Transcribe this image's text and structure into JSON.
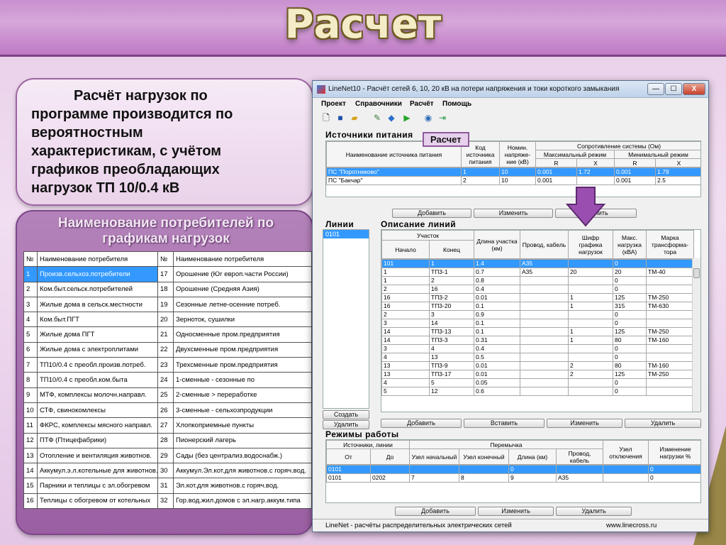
{
  "slide": {
    "title": "Расчет",
    "intro_lines": [
      "Расчёт нагрузок по",
      "программе производится по",
      "вероятностным",
      "характеристикам, с учётом",
      "графиков преобладающих",
      "нагрузок  ТП 10/0.4 кВ"
    ],
    "list_title_1": "Наименование потребителей по",
    "list_title_2": "графикам нагрузок"
  },
  "consumers": {
    "header": [
      "№",
      "Наименование потребителя",
      "№",
      "Наименование потребителя"
    ],
    "rows": [
      [
        "1",
        "Произв.сельхоз.потребители",
        "17",
        "Орошение (Юг европ.части России)"
      ],
      [
        "2",
        "Ком.быт.сельск.потребителей",
        "18",
        "Орошение (Средняя Азия)"
      ],
      [
        "3",
        "Жилые дома в сельск.местности",
        "19",
        "Сезонные летне-осенние потреб."
      ],
      [
        "4",
        "Ком.быт.ПГТ",
        "20",
        "Зерноток, сушилки"
      ],
      [
        "5",
        "Жилые дома ПГТ",
        "21",
        "Односменные пром.предприятия"
      ],
      [
        "6",
        "Жилые дома с электроплитами",
        "22",
        "Двухсменные пром.предприятия"
      ],
      [
        "7",
        "ТП10/0.4 с преобл.произв.потреб.",
        "23",
        "Трехсменные пром.предприятия"
      ],
      [
        "8",
        "ТП10/0.4 с преобл.ком.быта",
        "24",
        "1-сменные -  сезонные по"
      ],
      [
        "9",
        "МТФ, комплексы молочн.направл.",
        "25",
        "2-сменные  >  переработке"
      ],
      [
        "10",
        "СТФ, свинокомлексы",
        "26",
        "3-сменные -  сельхозпродукции"
      ],
      [
        "11",
        "ФКРС, комплексы мясного направл.",
        "27",
        "Хлопкоприемные пункты"
      ],
      [
        "12",
        "ПТФ (Птицефабрики)",
        "28",
        "Пионерский лагерь"
      ],
      [
        "13",
        "Отопление и вентиляция животнов.",
        "29",
        "Сады (без централиз.водоснабж.)"
      ],
      [
        "14",
        "Аккумул.э.л.котельные для животнов.",
        "30",
        "Аккумул.Эл.кот.для животнов.с горяч.вод."
      ],
      [
        "15",
        "Парники и теплицы с эл.обогревом",
        "31",
        "Эл.кот.для животнов.с горяч.вод."
      ],
      [
        "16",
        "Теплицы с обогревом от котельных",
        "32",
        "Гор.вод.жил.домов с эл.нагр.аккум.типа"
      ]
    ]
  },
  "window": {
    "title": "LineNet10 - Расчёт сетей 6, 10, 20 кВ на потери напряжения и токи короткого замыкания",
    "buttons": [
      "—",
      "☐",
      "X"
    ],
    "menu": [
      "Проект",
      "Справочники",
      "Расчёт",
      "Помощь"
    ],
    "tooltip": "Расчет",
    "status_left": "LineNet - расчёты распределительных электрических сетей",
    "status_right": "www.linecross.ru"
  },
  "sources": {
    "label": "Источники питания",
    "h_name": "Наименование источника питания",
    "h_code": "Код источника питания",
    "h_nom": "Номин. напряже-ние (кВ)",
    "h_res": "Сопротивление системы (Ом)",
    "h_max": "Максимальный режим",
    "h_min": "Минимальный режим",
    "h_r": "R",
    "h_x": "X",
    "rows": [
      [
        "ПС \"Поротниково\"",
        "1",
        "10",
        "0.001",
        "1.72",
        "0.001",
        "1.79"
      ],
      [
        "ПС \"Бакчар\"",
        "2",
        "10",
        "0.001",
        "",
        "0.001",
        "2.5"
      ]
    ],
    "btn_add": "Добавить",
    "btn_edit": "Изменить",
    "btn_del": "Удалить"
  },
  "lines": {
    "label": "Линии",
    "items": [
      "0101"
    ],
    "btn_create": "Создать",
    "btn_delete": "Удалить"
  },
  "desc": {
    "label": "Описание линий",
    "h_section": "Участок",
    "h_start": "Начало",
    "h_end": "Конец",
    "h_len": "Длина участка (км)",
    "h_wire": "Провод, кабель",
    "h_code": "Шифр графика нагрузок",
    "h_max": "Макс. нагрузка (кВА)",
    "h_tr": "Марка трансформа-тора",
    "rows": [
      [
        "101",
        "1",
        "1.4",
        "А35",
        "",
        "0",
        ""
      ],
      [
        "1",
        "ТП3-1",
        "0.7",
        "А35",
        "20",
        "20",
        "ТМ-40"
      ],
      [
        "1",
        "2",
        "0.8",
        "",
        "",
        "0",
        ""
      ],
      [
        "2",
        "16",
        "0.4",
        "",
        "",
        "0",
        ""
      ],
      [
        "16",
        "ТП3-2",
        "0.01",
        "",
        "1",
        "125",
        "ТМ-250"
      ],
      [
        "16",
        "ТП3-20",
        "0.1",
        "",
        "1",
        "315",
        "ТМ-630"
      ],
      [
        "2",
        "3",
        "0.9",
        "",
        "",
        "0",
        ""
      ],
      [
        "3",
        "14",
        "0.1",
        "",
        "",
        "0",
        ""
      ],
      [
        "14",
        "ТП3-13",
        "0.1",
        "",
        "1",
        "125",
        "ТМ-250"
      ],
      [
        "14",
        "ТП3-3",
        "0.31",
        "",
        "1",
        "80",
        "ТМ-160"
      ],
      [
        "3",
        "4",
        "0.4",
        "",
        "",
        "0",
        ""
      ],
      [
        "4",
        "13",
        "0.5",
        "",
        "",
        "0",
        ""
      ],
      [
        "13",
        "ТП3-9",
        "0.01",
        "",
        "2",
        "80",
        "ТМ-160"
      ],
      [
        "13",
        "ТП3-17",
        "0.01",
        "",
        "2",
        "125",
        "ТМ-250"
      ],
      [
        "4",
        "5",
        "0.05",
        "",
        "",
        "0",
        ""
      ],
      [
        "5",
        "12",
        "0.6",
        "",
        "",
        "0",
        ""
      ]
    ],
    "btn_add": "Добавить",
    "btn_insert": "Вставить",
    "btn_edit": "Изменить",
    "btn_delete": "Удалить"
  },
  "modes": {
    "label": "Режимы работы",
    "h_sources": "Источники, линии",
    "h_from": "От",
    "h_to": "До",
    "h_jumper": "Перемычка",
    "h_n1": "Узел начальный",
    "h_n2": "Узел конечный",
    "h_len": "Длина (км)",
    "h_wire": "Провод, кабель",
    "h_off": "Узел отключения",
    "h_change": "Изменение нагрузки %",
    "rows": [
      [
        "0101",
        "",
        "",
        "",
        "0",
        "",
        "",
        "0"
      ],
      [
        "0101",
        "0202",
        "7",
        "8",
        "9",
        "А35",
        "",
        "0"
      ]
    ],
    "btn_add": "Добавить",
    "btn_edit": "Изменить",
    "btn_delete": "Удалить"
  }
}
